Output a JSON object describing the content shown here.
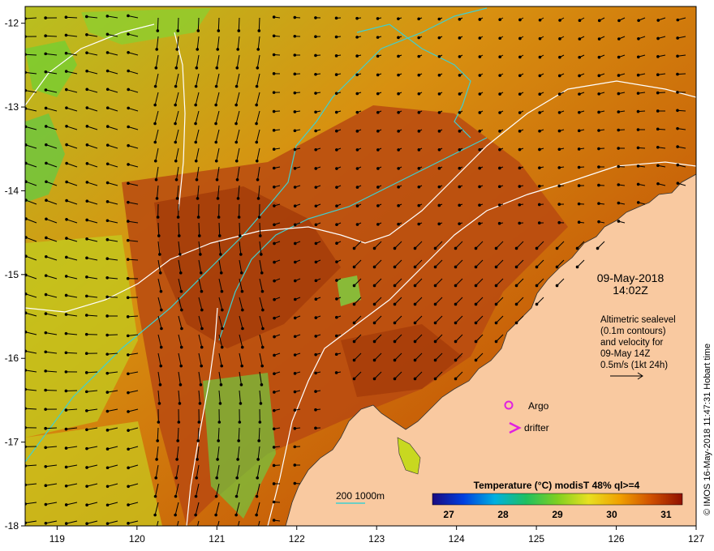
{
  "map": {
    "lon_range": [
      118.6,
      127.0
    ],
    "lat_range": [
      -18.0,
      -11.8
    ],
    "lon_ticks": [
      "119",
      "120",
      "121",
      "122",
      "123",
      "124",
      "125",
      "126",
      "127"
    ],
    "lat_ticks": [
      "-12",
      "-13",
      "-14",
      "-15",
      "-16",
      "-17",
      "-18"
    ],
    "colors": {
      "land": "#f9c9a0",
      "isobath": "#3fd0d0",
      "contour": "#ffffff",
      "argo": "#e020e0",
      "drifter": "#e020e0",
      "vector": "#000000"
    }
  },
  "annotations": {
    "date": "09-May-2018",
    "time": "14:02Z",
    "legend_lines": [
      "Altimetric sealevel",
      "(0.1m contours)",
      "and velocity for",
      "09-May 14Z",
      "0.5m/s (1kt 24h)"
    ],
    "argo_label": "Argo",
    "drifter_label": "drifter",
    "isobath_label": "200  1000m",
    "credit": "© IMOS 16-May-2018 11:47:31 Hobart time"
  },
  "colorbar": {
    "title": "Temperature  (°C) modisT 48% ql>=4",
    "ticks": [
      "27",
      "28",
      "29",
      "30",
      "31"
    ],
    "range": [
      26.7,
      31.3
    ],
    "stops": [
      "#1a0a80",
      "#0040e0",
      "#00b0e0",
      "#20c060",
      "#80d020",
      "#e8e020",
      "#f0a000",
      "#d05000",
      "#901000"
    ]
  }
}
